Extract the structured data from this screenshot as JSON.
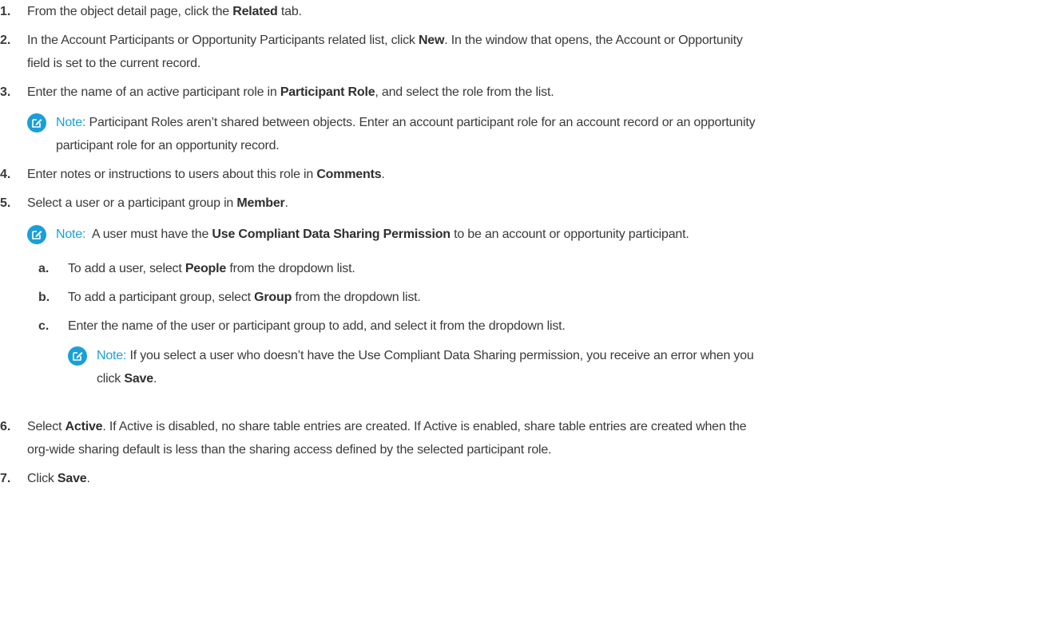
{
  "steps": [
    {
      "num": "1.",
      "pre": "From the object detail page, click the ",
      "bold": "Related",
      "post": " tab."
    },
    {
      "num": "2.",
      "line1_pre": "In the Account Participants or Opportunity Participants related list, click ",
      "line1_bold": "New",
      "line1_post": ". In the window that opens, the Account or Opportunity",
      "line2": "field is set to the current record."
    },
    {
      "num": "3.",
      "pre": "Enter the name of an active participant role in ",
      "bold": "Participant Role",
      "post": ", and select the role from the list."
    },
    {
      "num": "4.",
      "pre": "Enter notes or instructions to users about this role in ",
      "bold": "Comments",
      "post": "."
    },
    {
      "num": "5.",
      "pre": "Select a user or a participant group in ",
      "bold": "Member",
      "post": "."
    },
    {
      "num": "6.",
      "pre": "Select ",
      "bold": "Active",
      "line1_post": ". If Active is disabled, no share table entries are created. If Active is enabled, share table entries are created when the",
      "line2": "org-wide sharing default is less than the sharing access defined by the selected participant role."
    },
    {
      "num": "7.",
      "pre": "Click ",
      "bold": "Save",
      "post": "."
    }
  ],
  "substeps": [
    {
      "num": "a.",
      "pre": "To add a user, select ",
      "bold": "People",
      "post": " from the dropdown list."
    },
    {
      "num": "b.",
      "pre": "To add a participant group, select ",
      "bold": "Group",
      "post": " from the dropdown list."
    },
    {
      "num": "c.",
      "text": "Enter the name of the user or participant group to add, and select it from the dropdown list."
    }
  ],
  "notes": {
    "label": "Note:",
    "n1_line1": "Participant Roles aren’t shared between objects. Enter an account participant role for an account record or an opportunity",
    "n1_line2": "participant role for an opportunity record.",
    "n2_pre": "A user must have the ",
    "n2_bold": "Use Compliant Data Sharing Permission",
    "n2_post": " to be an account or opportunity participant.",
    "n3_line1": "If you select a user who doesn’t have the Use Compliant Data Sharing permission, you receive an error when you",
    "n3_line2_pre": "click ",
    "n3_line2_bold": "Save",
    "n3_line2_post": "."
  },
  "colors": {
    "note_accent": "#1a9fd8",
    "text": "#3a3a3a"
  }
}
